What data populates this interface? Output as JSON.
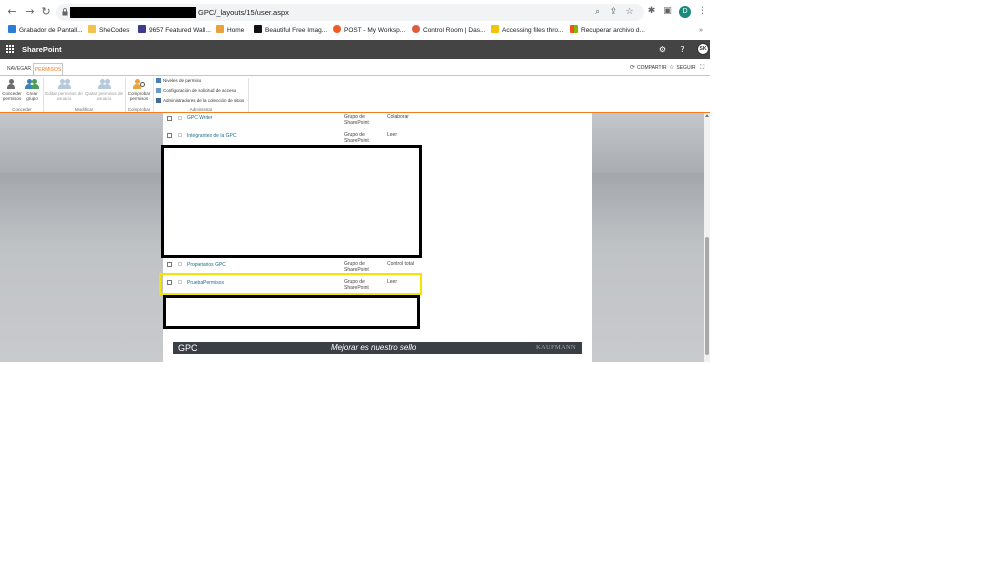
{
  "browser": {
    "url_path": "GPC/_layouts/15/user.aspx",
    "back_glyph": "←",
    "forward_glyph": "→",
    "reload_glyph": "↻",
    "profile_initial": "D",
    "profile_color": "#1a8a7a"
  },
  "bookmarks": [
    {
      "label": "Grabador de Pantall...",
      "icon_color": "#2a7fd4",
      "icon": "screen-recorder-icon"
    },
    {
      "label": "SheCodes",
      "icon_color": "#f2c14e",
      "icon": "folder-icon"
    },
    {
      "label": "9657 Featured Wall...",
      "icon_color": "#3b3b8f",
      "icon": "wallpaper-icon"
    },
    {
      "label": "Home",
      "icon_color": "#e8a33c",
      "icon": "home-bookmark-icon"
    },
    {
      "label": "Beautiful Free Imag...",
      "icon_color": "#111111",
      "icon": "unsplash-icon"
    },
    {
      "label": "POST - My Worksp...",
      "icon_color": "#ef5b25",
      "icon": "postman-icon"
    },
    {
      "label": "Control Room | Das...",
      "icon_color": "#e05a3b",
      "icon": "control-room-icon"
    },
    {
      "label": "Accessing files thro...",
      "icon_color": "#f4c20d",
      "icon": "drive-icon"
    },
    {
      "label": "Recuperar archivo d...",
      "icon_color": "#0078d4",
      "icon": "microsoft-icon"
    }
  ],
  "bookmarks_more": "»",
  "suite": {
    "brand": "SharePoint",
    "help": "?",
    "avatar": "SK"
  },
  "ribbon": {
    "tabs": {
      "navegar": "NAVEGAR",
      "permisos": "PERMISOS"
    },
    "actions": {
      "compartir": "COMPARTIR",
      "seguir": "SEGUIR"
    },
    "buttons": {
      "conceder": "Conceder permisos",
      "crear": "Crear grupo",
      "editar": "Editar permisos de usuario",
      "quitar": "Quitar permisos de usuario",
      "comprobar": "Comprobar permisos"
    },
    "small": {
      "niveles": "Niveles de permiso",
      "configuracion": "Configuración de solicitud de acceso",
      "administradores": "Administradores de la colección de sitios"
    },
    "groups": {
      "conceder": "Conceder",
      "modificar": "Modificar",
      "comprobar": "Comprobar",
      "administrar": "Administrar"
    }
  },
  "rows": [
    {
      "name": "GPC Writer",
      "type": "Grupo de SharePoint",
      "perm": "Colaborar"
    },
    {
      "name": "Integrantes de la GPC",
      "type": "Grupo de SharePoint",
      "perm": "Leer"
    },
    {
      "name": "Propietarios GPC",
      "type": "Grupo de SharePoint",
      "perm": "Control total"
    },
    {
      "name": "PruebaPermisos",
      "type": "Grupo de SharePoint",
      "perm": "Leer"
    }
  ],
  "footer": {
    "left": "GPC",
    "middle": "Mejorar es nuestro sello",
    "right": "KAUFMANN"
  },
  "colors": {
    "suite_bar": "#444444",
    "accent_orange": "#f47c20",
    "highlight_yellow": "#f5e400",
    "link_teal": "#1f6e8c"
  }
}
